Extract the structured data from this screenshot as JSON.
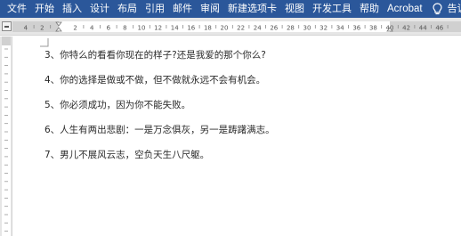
{
  "ribbon": {
    "tabs": [
      "文件",
      "开始",
      "插入",
      "设计",
      "布局",
      "引用",
      "邮件",
      "审阅",
      "新建选项卡",
      "视图",
      "开发工具",
      "帮助",
      "Acrobat"
    ],
    "tell_me": "告诉我",
    "accent_color": "#2b579a"
  },
  "ruler": {
    "labels": [
      "4",
      "2",
      "2",
      "4",
      "6",
      "8",
      "10",
      "12",
      "14",
      "16",
      "18",
      "20",
      "22",
      "24",
      "26",
      "28",
      "30",
      "32",
      "34",
      "36",
      "38",
      "40",
      "42",
      "44",
      "46",
      "48"
    ]
  },
  "document": {
    "lines": [
      "3、你特么的看看你现在的样子?还是我爱的那个你么?",
      "4、你的选择是做或不做，但不做就永远不会有机会。",
      "5、你必须成功，因为你不能失败。",
      "6、人生有两出悲剧：一是万念俱灰，另一是踌躇满志。",
      "7、男儿不展风云志，空负天生八尺躯。"
    ]
  },
  "icons": [
    "lightbulb-icon",
    "user-icon"
  ]
}
